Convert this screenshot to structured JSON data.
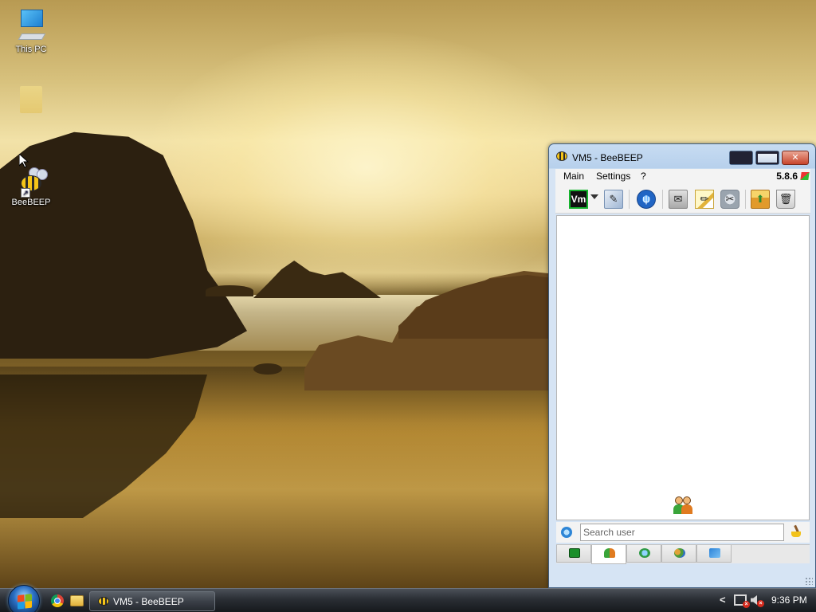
{
  "desktop": {
    "icons": [
      {
        "label": "This PC",
        "icon": "computer-icon"
      },
      {
        "label": "",
        "icon": "folder-icon"
      },
      {
        "label": "BeeBEEP",
        "icon": "beebeep-bee-icon"
      }
    ]
  },
  "window": {
    "title": "VM5 - BeeBEEP",
    "controls": {
      "minimize": "minimize",
      "maximize": "maximize",
      "close": "✕"
    },
    "menu": {
      "main": "Main",
      "settings": "Settings",
      "help": "?"
    },
    "version": "5.8.6",
    "toolbar": {
      "vm_label": "Vm",
      "buttons": [
        "status-vm",
        "status-dropdown",
        "profile",
        "network",
        "mail",
        "edit-note",
        "tools",
        "share-folder",
        "trash"
      ]
    },
    "search": {
      "placeholder": "Search user",
      "value": ""
    },
    "tabs": [
      "chat-list",
      "users",
      "group-chats",
      "groups",
      "shares"
    ]
  },
  "taskbar": {
    "task_label": "VM5 - BeeBEEP",
    "tray": {
      "chevron": "<",
      "clock": "9:36 PM"
    }
  },
  "colors": {
    "window_border": "#3f5d80",
    "close_button": "#c8452c",
    "taskbar": "#2a2e34",
    "vm_border": "#16b32e"
  }
}
